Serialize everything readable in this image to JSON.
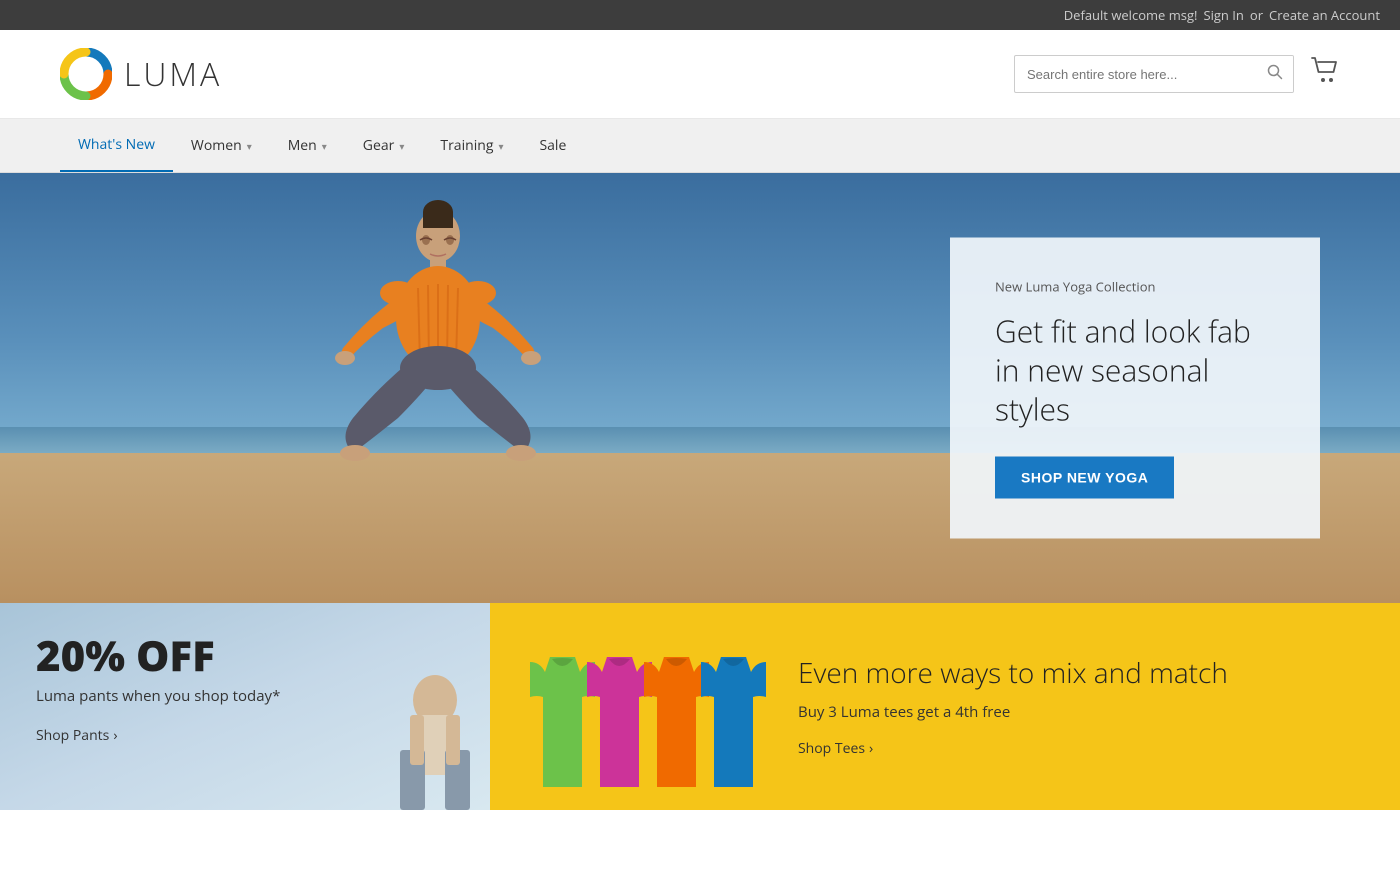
{
  "topbar": {
    "welcome": "Default welcome msg!",
    "signin": "Sign In",
    "or": "or",
    "create_account": "Create an Account"
  },
  "header": {
    "logo_text": "LUMA",
    "search_placeholder": "Search entire store here...",
    "cart_label": "Cart"
  },
  "nav": {
    "items": [
      {
        "label": "What's New",
        "has_dropdown": false
      },
      {
        "label": "Women",
        "has_dropdown": true
      },
      {
        "label": "Men",
        "has_dropdown": true
      },
      {
        "label": "Gear",
        "has_dropdown": true
      },
      {
        "label": "Training",
        "has_dropdown": true
      },
      {
        "label": "Sale",
        "has_dropdown": false
      }
    ]
  },
  "hero": {
    "subtitle": "New Luma Yoga Collection",
    "title": "Get fit and look fab in new seasonal styles",
    "cta_label": "Shop New Yoga"
  },
  "promo_left": {
    "discount": "20% OFF",
    "description": "Luma pants when you shop today*",
    "link": "Shop Pants",
    "link_arrow": "›"
  },
  "promo_right": {
    "title": "Even more ways to mix and match",
    "description": "Buy 3 Luma tees get a 4th free",
    "link": "Shop Tees",
    "link_arrow": "›",
    "tshirts": [
      {
        "color": "#6cc24a",
        "label": "green"
      },
      {
        "color": "#cc3399",
        "label": "pink"
      },
      {
        "color": "#f06a00",
        "label": "orange"
      },
      {
        "color": "#1479bb",
        "label": "blue"
      }
    ]
  }
}
